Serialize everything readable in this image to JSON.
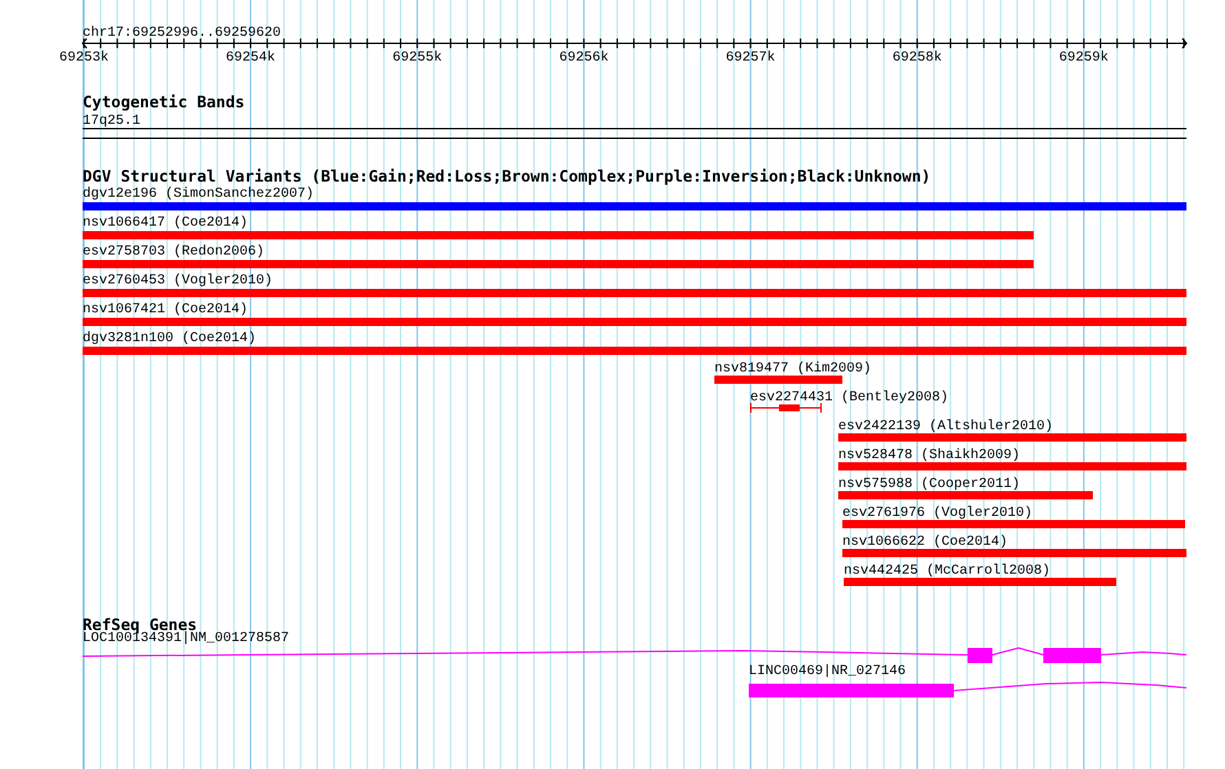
{
  "ruler": {
    "location": "chr17:69252996..69259620",
    "ticks": [
      "69253k",
      "69254k",
      "69255k",
      "69256k",
      "69257k",
      "69258k",
      "69259k"
    ]
  },
  "tracks": [
    {
      "kind": "bands",
      "title": "Cytogenetic Bands",
      "features": [
        {
          "label": "17q25.1"
        }
      ]
    },
    {
      "kind": "variants",
      "title": "DGV Structural Variants (Blue:Gain;Red:Loss;Brown:Complex;Purple:Inversion;Black:Unknown)",
      "features": [
        {
          "label": "dgv12e196 (SimonSanchez2007)",
          "color": "#0000ff",
          "kind": "bar"
        },
        {
          "label": "nsv1066417 (Coe2014)",
          "color": "#ff0000",
          "kind": "bar"
        },
        {
          "label": "esv2758703 (Redon2006)",
          "color": "#ff0000",
          "kind": "bar"
        },
        {
          "label": "esv2760453 (Vogler2010)",
          "color": "#ff0000",
          "kind": "bar"
        },
        {
          "label": "nsv1067421 (Coe2014)",
          "color": "#ff0000",
          "kind": "bar"
        },
        {
          "label": "dgv3281n100 (Coe2014)",
          "color": "#ff0000",
          "kind": "bar"
        },
        {
          "label": "nsv819477 (Kim2009)",
          "color": "#ff0000",
          "kind": "bar"
        },
        {
          "label": "esv2274431 (Bentley2008)",
          "color": "#ff0000",
          "kind": "interval"
        },
        {
          "label": "esv2422139 (Altshuler2010)",
          "color": "#ff0000",
          "kind": "bar"
        },
        {
          "label": "nsv528478 (Shaikh2009)",
          "color": "#ff0000",
          "kind": "bar"
        },
        {
          "label": "nsv575988 (Cooper2011)",
          "color": "#ff0000",
          "kind": "bar"
        },
        {
          "label": "esv2761976 (Vogler2010)",
          "color": "#ff0000",
          "kind": "bar"
        },
        {
          "label": "nsv1066622 (Coe2014)",
          "color": "#ff0000",
          "kind": "bar"
        },
        {
          "label": "nsv442425 (McCarroll2008)",
          "color": "#ff0000",
          "kind": "bar"
        }
      ]
    },
    {
      "kind": "genes",
      "title": "RefSeq Genes",
      "features": [
        {
          "label": "LOC100134391|NM_001278587"
        },
        {
          "label": "LINC00469|NR_027146"
        }
      ]
    }
  ]
}
